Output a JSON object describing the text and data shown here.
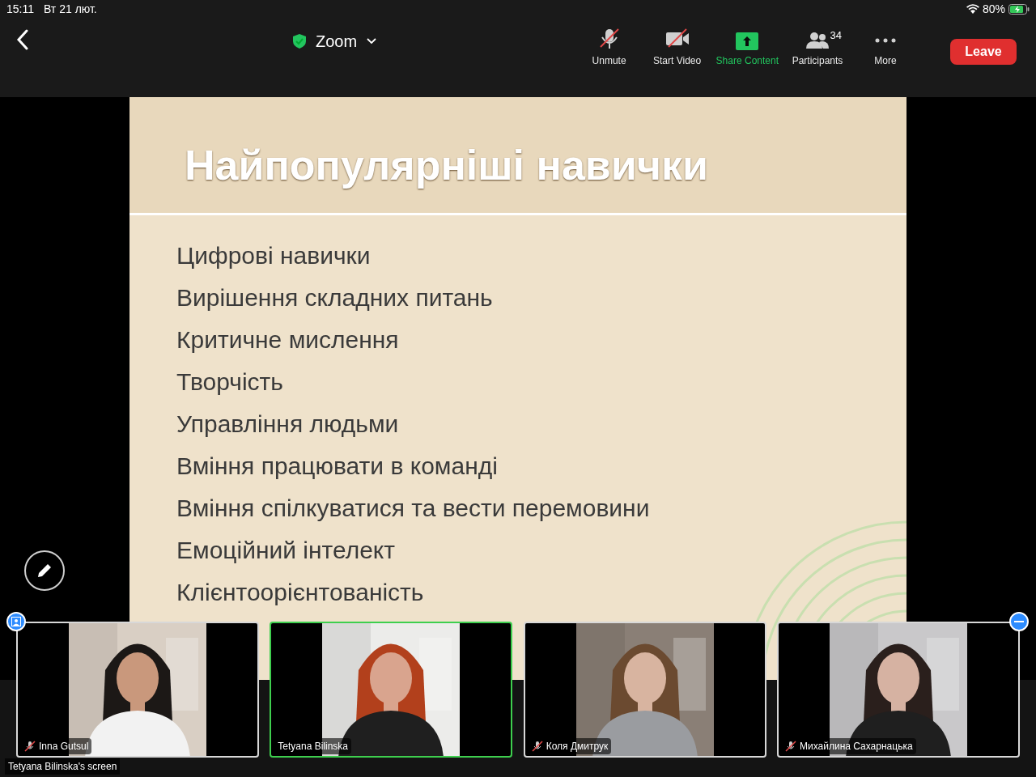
{
  "status_bar": {
    "time": "15:11",
    "date": "Вт 21 лют.",
    "battery": "80%"
  },
  "toolbar": {
    "title": "Zoom",
    "items": [
      {
        "kind": "mic",
        "label": "Unmute",
        "off": true
      },
      {
        "kind": "video",
        "label": "Start Video",
        "off": true
      },
      {
        "kind": "share",
        "label": "Share Content"
      },
      {
        "kind": "participants",
        "label": "Participants",
        "count": "34"
      },
      {
        "kind": "more",
        "label": "More"
      }
    ],
    "leave": "Leave"
  },
  "slide": {
    "title": "Найпопулярніші навички",
    "items": [
      "Цифрові навички",
      "Вирішення складних питань",
      "Критичне мислення",
      "Творчість",
      "Управління людьми",
      "Вміння працювати в команді",
      "Вміння спілкуватися та вести перемовини",
      "Емоційний інтелект",
      "Клієнтоорієнтованість"
    ]
  },
  "videos": [
    {
      "name": "Inna Gutsul",
      "muted": true,
      "selected": false
    },
    {
      "name": "Tetyana Bilinska",
      "muted": false,
      "selected": true
    },
    {
      "name": "Коля Дмитрук",
      "muted": true,
      "selected": false
    },
    {
      "name": "Михайлина Сахарнацька",
      "muted": true,
      "selected": false
    }
  ],
  "share_caption": "Tetyana Bilinska's screen"
}
